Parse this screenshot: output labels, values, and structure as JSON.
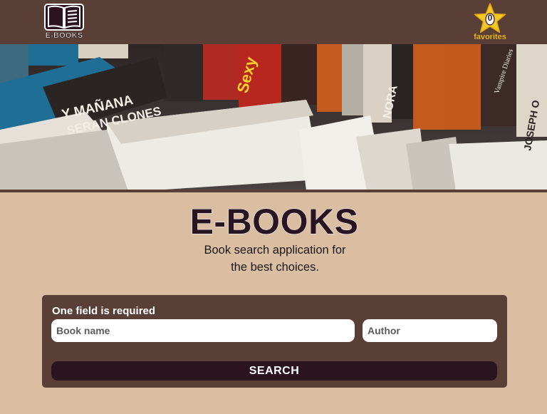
{
  "header": {
    "logo_text": "E-BOOKS",
    "favorites": {
      "count": "0",
      "label": "favorites"
    }
  },
  "hero": {
    "image": "bookshelf-photo",
    "visible_spine_text": [
      "Y MAÑANA",
      "SERAN CLONES",
      "Sexy",
      "NORA",
      "Vampire Diaries",
      "JOSEPH O"
    ]
  },
  "main": {
    "title": "E-BOOKS",
    "subtitle_line1": "Book search application for",
    "subtitle_line2": "the best choices."
  },
  "form": {
    "required_text": "One field is required",
    "book_placeholder": "Book name",
    "author_placeholder": "Author",
    "search_label": "SEARCH"
  },
  "colors": {
    "header_bg": "#5a3f37",
    "page_bg": "#d9bea1",
    "accent_dark": "#2b1420",
    "star": "#f6c825"
  }
}
